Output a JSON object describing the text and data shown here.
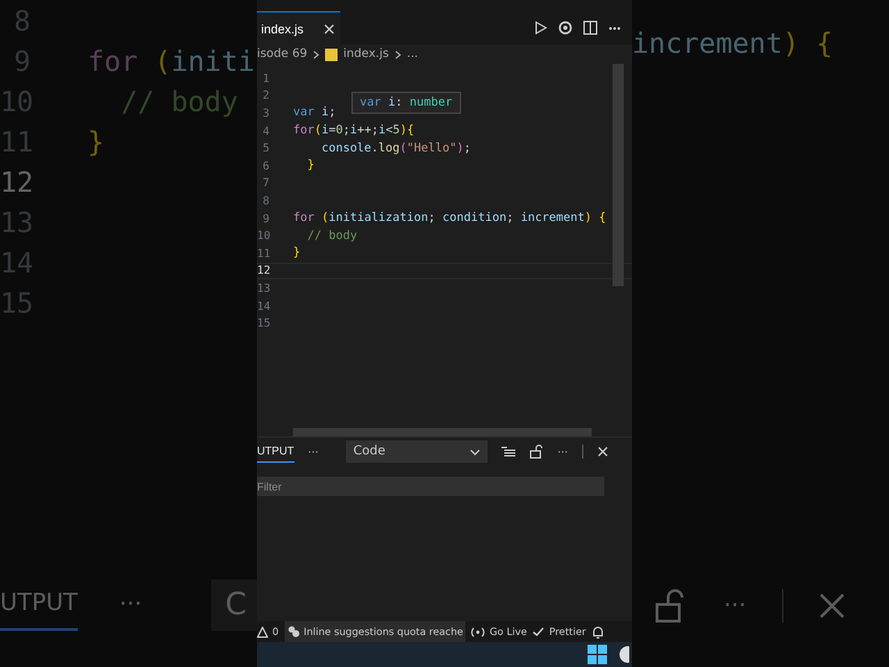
{
  "backdrop_left": {
    "lines": [
      {
        "number": "8",
        "active": false
      },
      {
        "number": "9",
        "active": false,
        "tokens": [
          {
            "kind": "control",
            "text": "for "
          },
          {
            "kind": "paren",
            "text": "("
          },
          {
            "kind": "variable",
            "text": "initi"
          }
        ]
      },
      {
        "number": "10",
        "active": false,
        "tokens": [
          {
            "kind": "comment",
            "text": "  // body"
          }
        ]
      },
      {
        "number": "11",
        "active": false,
        "tokens": [
          {
            "kind": "paren",
            "text": "}"
          }
        ]
      },
      {
        "number": "12",
        "active": true
      },
      {
        "number": "13",
        "active": false
      },
      {
        "number": "14",
        "active": false
      },
      {
        "number": "15",
        "active": false
      }
    ],
    "panel_tab": {
      "label": "UTPUT",
      "selected": true
    },
    "panel_more": "···",
    "panel_select": "C"
  },
  "backdrop_right": {
    "tokens": [
      {
        "kind": "variable",
        "text": "increment"
      },
      {
        "kind": "paren",
        "text": ") {"
      }
    ],
    "panel_more": "···"
  },
  "editor": {
    "tab": {
      "label": "index.js",
      "selected": true
    },
    "breadcrumb": [
      "isode 69",
      "index.js",
      "..."
    ],
    "lines": [
      {
        "number": "1",
        "active": false
      },
      {
        "number": "2",
        "active": false
      },
      {
        "number": "3",
        "active": false,
        "tokens": [
          {
            "kind": "storage",
            "text": "var "
          },
          {
            "kind": "variable",
            "text": "i"
          },
          {
            "kind": "plain",
            "text": ";"
          }
        ]
      },
      {
        "number": "4",
        "active": false,
        "tokens": [
          {
            "kind": "control",
            "text": "for"
          },
          {
            "kind": "paren",
            "text": "("
          },
          {
            "kind": "variable",
            "text": "i"
          },
          {
            "kind": "plain",
            "text": "="
          },
          {
            "kind": "number",
            "text": "0"
          },
          {
            "kind": "plain",
            "text": ";"
          },
          {
            "kind": "variable",
            "text": "i"
          },
          {
            "kind": "plain",
            "text": "++;"
          },
          {
            "kind": "variable",
            "text": "i"
          },
          {
            "kind": "plain",
            "text": "<"
          },
          {
            "kind": "number",
            "text": "5"
          },
          {
            "kind": "paren",
            "text": "){"
          }
        ]
      },
      {
        "number": "5",
        "active": false,
        "tokens": [
          {
            "kind": "variable",
            "text": "    console"
          },
          {
            "kind": "plain",
            "text": "."
          },
          {
            "kind": "func",
            "text": "log"
          },
          {
            "kind": "paren2",
            "text": "("
          },
          {
            "kind": "string",
            "text": "\"Hello\""
          },
          {
            "kind": "paren2",
            "text": ")"
          },
          {
            "kind": "plain",
            "text": ";"
          }
        ]
      },
      {
        "number": "6",
        "active": false,
        "tokens": [
          {
            "kind": "paren",
            "text": "  }"
          }
        ]
      },
      {
        "number": "7",
        "active": false
      },
      {
        "number": "8",
        "active": false
      },
      {
        "number": "9",
        "active": false,
        "tokens": [
          {
            "kind": "control",
            "text": "for "
          },
          {
            "kind": "paren",
            "text": "("
          },
          {
            "kind": "variable",
            "text": "initialization"
          },
          {
            "kind": "plain",
            "text": "; "
          },
          {
            "kind": "variable",
            "text": "condition"
          },
          {
            "kind": "plain",
            "text": "; "
          },
          {
            "kind": "variable",
            "text": "increment"
          },
          {
            "kind": "paren",
            "text": ") {"
          }
        ]
      },
      {
        "number": "10",
        "active": false,
        "tokens": [
          {
            "kind": "comment",
            "text": "  // body"
          }
        ]
      },
      {
        "number": "11",
        "active": false,
        "tokens": [
          {
            "kind": "paren",
            "text": "}"
          }
        ]
      },
      {
        "number": "12",
        "active": true
      },
      {
        "number": "13",
        "active": false
      },
      {
        "number": "14",
        "active": false
      },
      {
        "number": "15",
        "active": false
      }
    ],
    "hover": {
      "tokens": [
        {
          "kind": "storage",
          "text": "var "
        },
        {
          "kind": "variable",
          "text": "i"
        },
        {
          "kind": "plain",
          "text": ": "
        },
        {
          "kind": "type",
          "text": "number"
        }
      ]
    }
  },
  "panel": {
    "tab": {
      "label": "UTPUT",
      "selected": true
    },
    "more": "···",
    "select": "Code",
    "more2": "···",
    "filter": {
      "placeholder": "Filter"
    }
  },
  "status_bar": {
    "warnings": "0",
    "suggestions": "Inline suggestions quota reache",
    "go_live": "Go Live",
    "prettier": "Prettier"
  }
}
